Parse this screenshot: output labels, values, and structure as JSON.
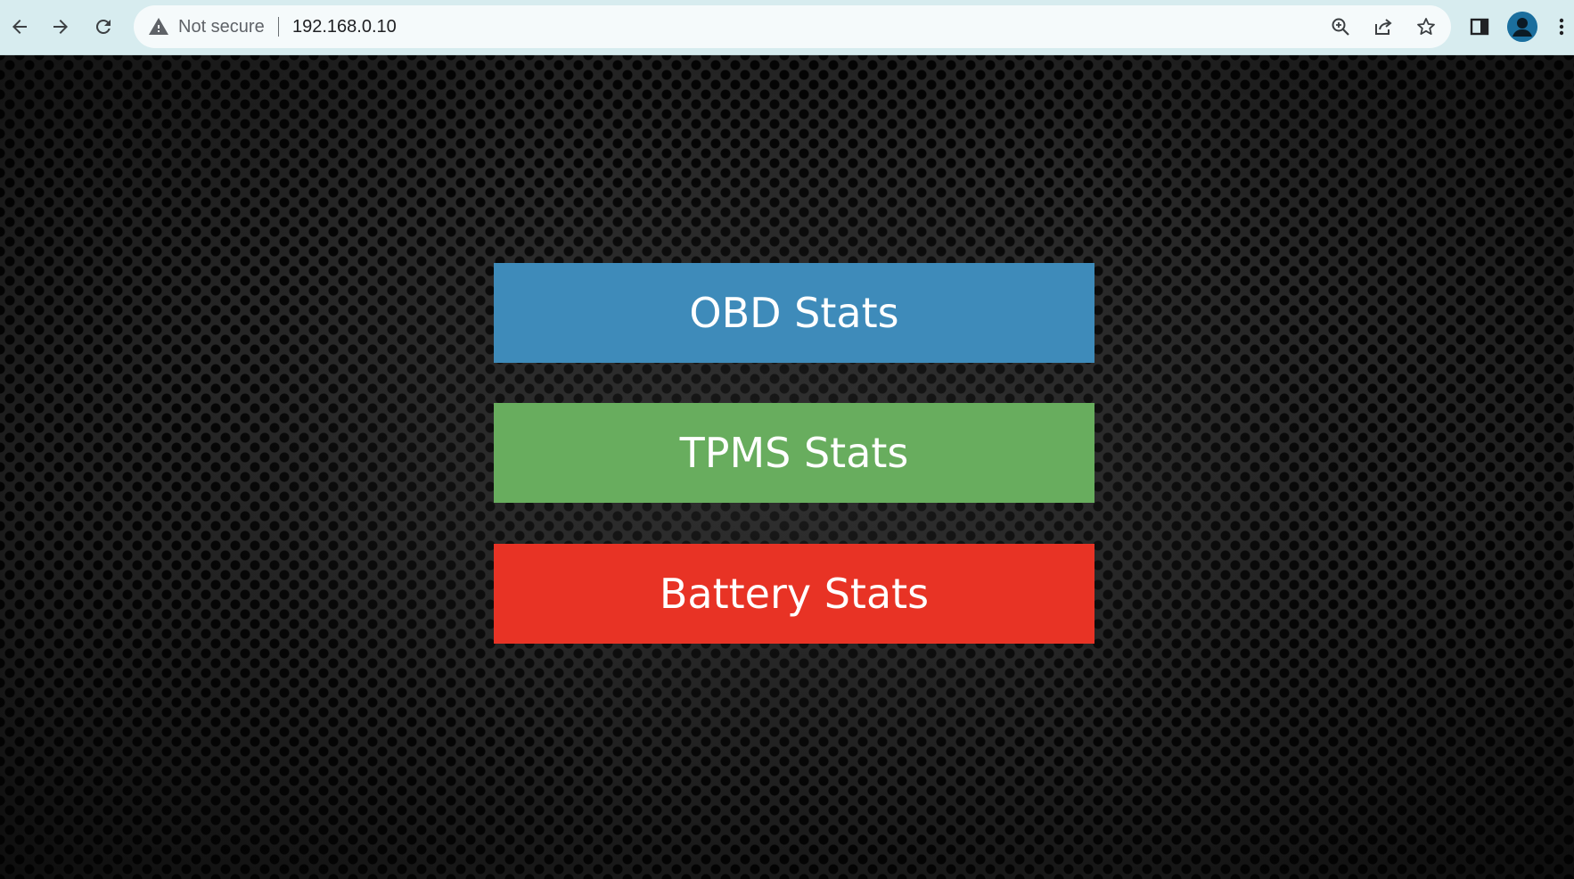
{
  "browser": {
    "security_label": "Not secure",
    "url": "192.168.0.10",
    "icons": {
      "back": "arrow-left-icon",
      "forward": "arrow-right-icon",
      "reload": "reload-icon",
      "warning": "warning-icon",
      "zoom": "zoom-icon",
      "share": "share-icon",
      "bookmark": "star-icon",
      "side_panel": "side-panel-icon",
      "profile": "avatar",
      "menu": "kebab-menu-icon"
    }
  },
  "main": {
    "buttons": [
      {
        "label": "OBD Stats",
        "color": "#3e8bba"
      },
      {
        "label": "TPMS Stats",
        "color": "#68ad5e"
      },
      {
        "label": "Battery Stats",
        "color": "#e83325"
      }
    ]
  }
}
